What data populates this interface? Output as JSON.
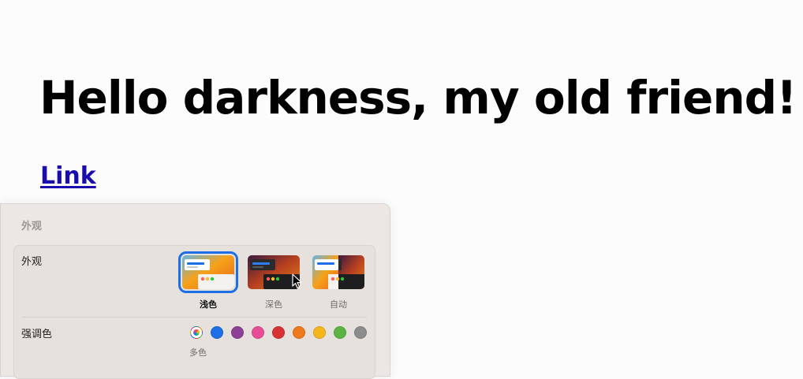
{
  "page": {
    "heading": "Hello darkness, my old friend!",
    "link": "Link"
  },
  "panel": {
    "header": "外观",
    "appearance": {
      "label": "外观",
      "options": [
        {
          "label": "浅色",
          "selected": true,
          "theme": "light"
        },
        {
          "label": "深色",
          "selected": false,
          "theme": "dark"
        },
        {
          "label": "自动",
          "selected": false,
          "theme": "auto"
        }
      ]
    },
    "accent": {
      "label": "强调色",
      "colors": [
        "multicolor",
        "#1f6fe8",
        "#8e3f96",
        "#e84d96",
        "#d93234",
        "#ee7a1b",
        "#f5b61c",
        "#5bb442",
        "#8c8c8c"
      ],
      "caption": "多色"
    }
  },
  "colors": {
    "link": "#1a0dab",
    "selection": "#1d6fe6",
    "panel_bg": "#ece7e4"
  }
}
